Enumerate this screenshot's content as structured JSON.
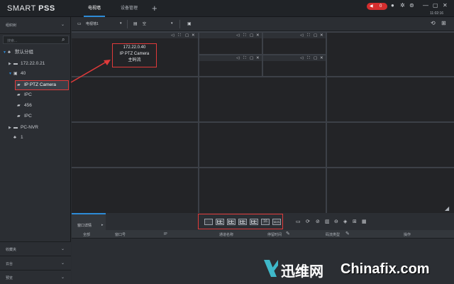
{
  "app": {
    "title_light": "SMART ",
    "title_bold": "PSS",
    "clock": "11:02:16"
  },
  "tabs": [
    {
      "label": "电视墙",
      "active": true
    },
    {
      "label": "设备管理",
      "active": false
    }
  ],
  "alarm": {
    "count": "0",
    "color": "#d42e2e"
  },
  "sidebar": {
    "header": "组织树",
    "search_placeholder": "搜索...",
    "tree": [
      {
        "label": "默认分组",
        "icon": "group-icon",
        "level": 0,
        "expanded": true
      },
      {
        "label": "172.22.0.21",
        "icon": "nvr-icon",
        "level": 1,
        "expanded": false
      },
      {
        "label": "40",
        "icon": "device-icon",
        "level": 1,
        "expanded": true
      },
      {
        "label": "IP PTZ Camera",
        "icon": "camera-icon",
        "level": 2,
        "selected": true
      },
      {
        "label": "IPC",
        "icon": "camera-icon",
        "level": 2
      },
      {
        "label": "456",
        "icon": "camera-icon",
        "level": 2
      },
      {
        "label": "IPC",
        "icon": "camera-icon",
        "level": 2
      },
      {
        "label": "PC-NVR",
        "icon": "nvr-icon",
        "level": 1,
        "expanded": false
      },
      {
        "label": "1",
        "icon": "group-icon",
        "level": 1
      }
    ],
    "bottom_sections": [
      "收藏夹",
      "云台",
      "预览"
    ]
  },
  "toolbar": {
    "wall_select": "电视墙1",
    "plan_select": "空"
  },
  "camera_overlay": {
    "ip": "172.22.0.40",
    "name": "IP PTZ Camera",
    "stream": "主码流"
  },
  "bottom": {
    "tab_label": "窗口详情",
    "layout_btn_16": "16",
    "layout_btn_custom": "M×N",
    "columns": [
      "全部",
      "窗口号",
      "IP",
      "通道名称",
      "停留时间",
      "码流类型",
      "操作"
    ]
  },
  "watermark": {
    "cn": "迅维网",
    "en": "Chinafix.com"
  },
  "colors": {
    "accent": "#2d8bd6",
    "highlight": "#e03a3a"
  }
}
